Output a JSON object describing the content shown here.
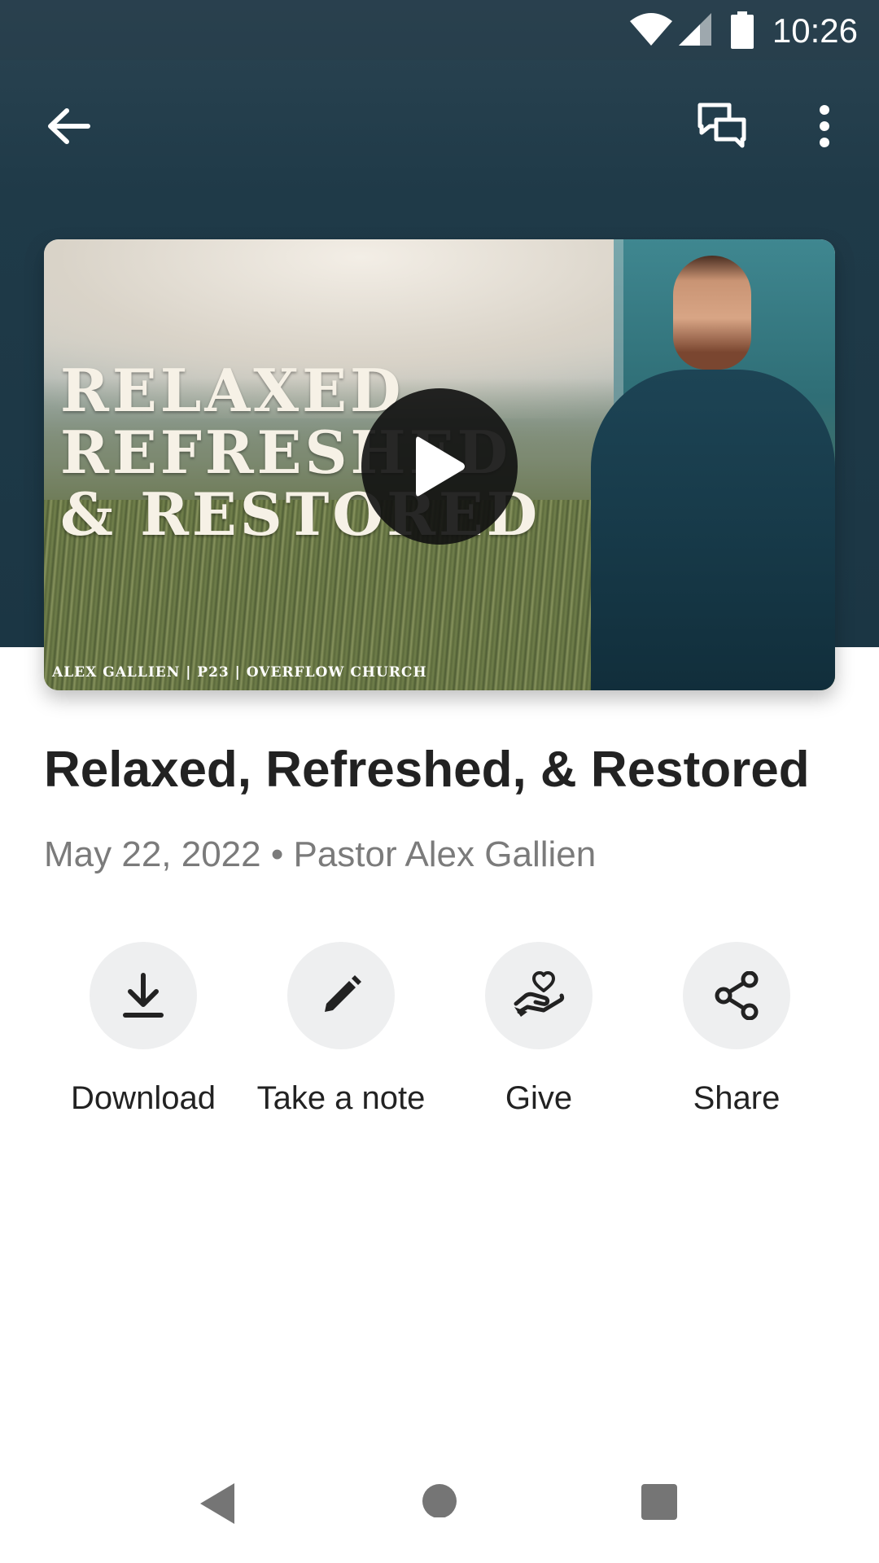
{
  "status_bar": {
    "time": "10:26",
    "icons": [
      "wifi-icon",
      "cellular-signal-icon",
      "battery-icon"
    ]
  },
  "toolbar": {
    "back_icon": "arrow-back-icon",
    "chat_icon": "chat-bubbles-icon",
    "more_icon": "more-vert-icon"
  },
  "media": {
    "thumbnail_title_lines": [
      "RELAXED",
      "REFRESHED",
      "& RESTORED"
    ],
    "thumbnail_credit": "ALEX GALLIEN | P23 | OVERFLOW CHURCH",
    "play_icon": "play-icon"
  },
  "sermon": {
    "title": "Relaxed, Refreshed, & Restored",
    "meta": "May 22, 2022 • Pastor Alex Gallien"
  },
  "actions": [
    {
      "label": "Download",
      "icon": "download-icon"
    },
    {
      "label": "Take a note",
      "icon": "pencil-icon"
    },
    {
      "label": "Give",
      "icon": "give-heart-hand-icon"
    },
    {
      "label": "Share",
      "icon": "share-icon"
    }
  ],
  "nav_bar": {
    "icons": [
      "back-triangle-icon",
      "home-circle-icon",
      "recents-square-icon"
    ]
  },
  "colors": {
    "header": "#1f3a48",
    "action_circle": "#eeeff0",
    "title_text": "#222222",
    "meta_text": "#7b7b7b"
  }
}
